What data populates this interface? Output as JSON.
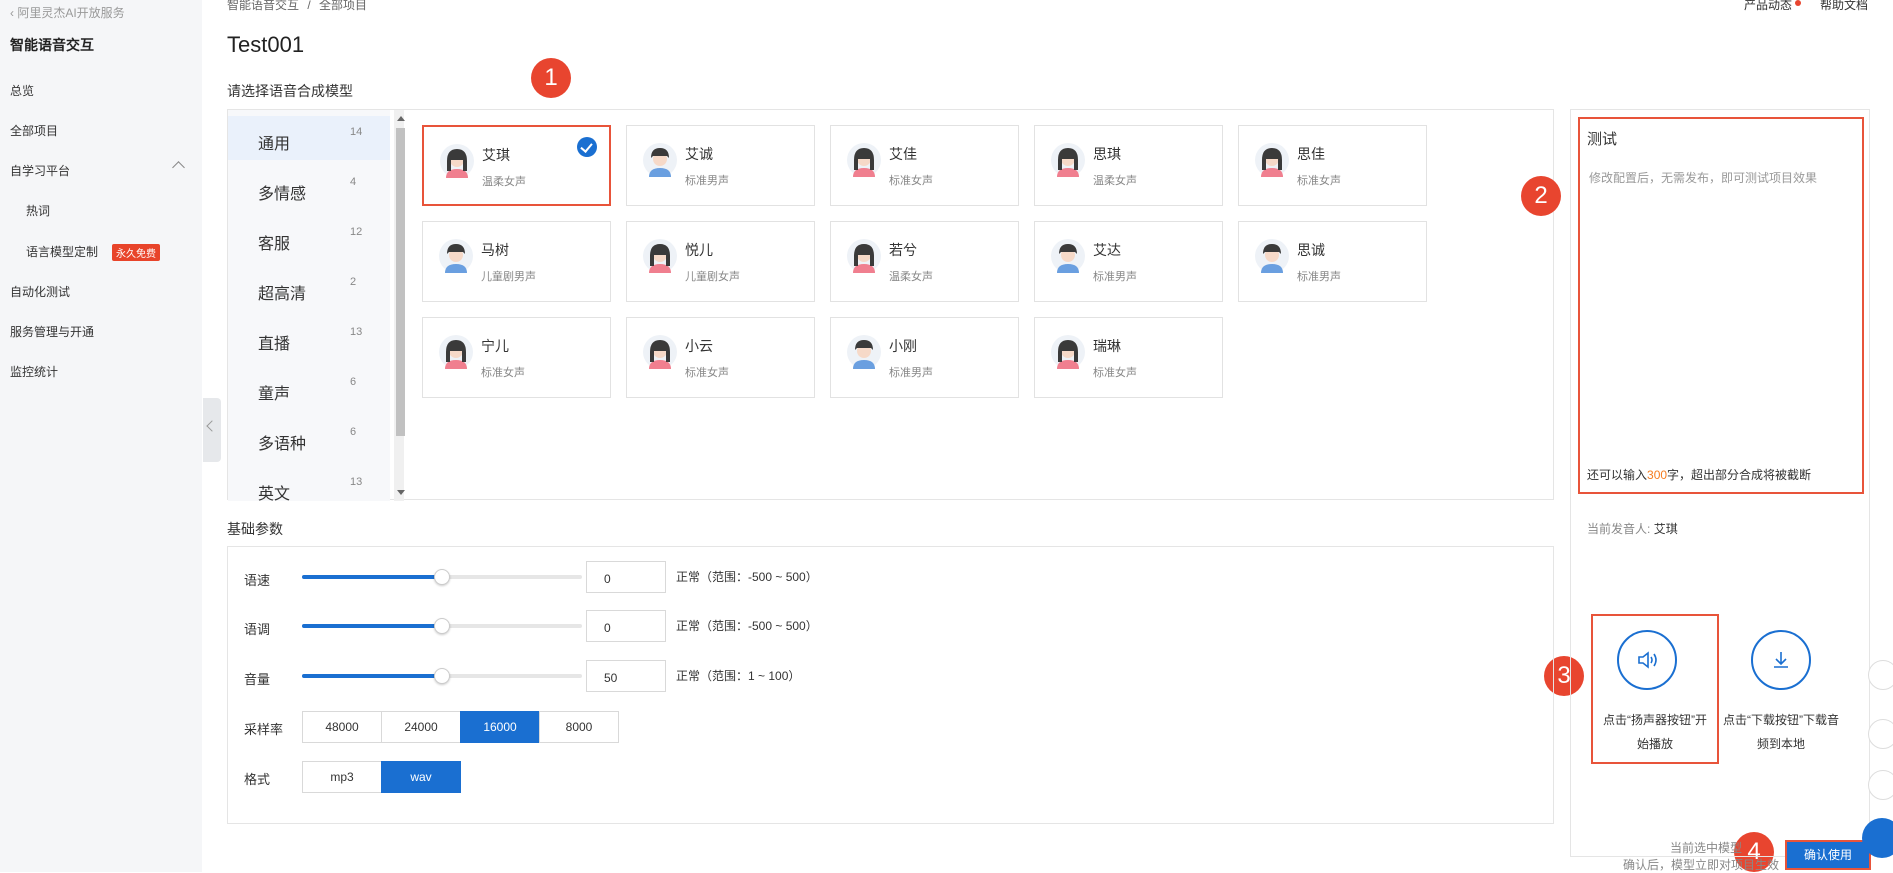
{
  "sidebar": {
    "back_label": "阿里灵杰AI开放服务",
    "title": "智能语音交互",
    "items": [
      {
        "label": "总览"
      },
      {
        "label": "全部项目"
      },
      {
        "label": "自学习平台"
      },
      {
        "label": "热词"
      },
      {
        "label": "语言模型定制"
      },
      {
        "label": "自动化测试"
      },
      {
        "label": "服务管理与开通"
      },
      {
        "label": "监控统计"
      }
    ],
    "free_badge": "永久免费"
  },
  "header": {
    "breadcrumb": [
      "智能语音交互",
      "/",
      "全部项目"
    ],
    "product_news": "产品动态",
    "help_docs": "帮助文档"
  },
  "page_title": "Test001",
  "model_section_label": "请选择语音合成模型",
  "categories": [
    {
      "name": "通用",
      "count": "14"
    },
    {
      "name": "多情感",
      "count": "4"
    },
    {
      "name": "客服",
      "count": "12"
    },
    {
      "name": "超高清",
      "count": "2"
    },
    {
      "name": "直播",
      "count": "13"
    },
    {
      "name": "童声",
      "count": "6"
    },
    {
      "name": "多语种",
      "count": "6"
    },
    {
      "name": "英文",
      "count": "13"
    }
  ],
  "voices": [
    {
      "name": "艾琪",
      "desc": "温柔女声",
      "gender": "female",
      "selected": true
    },
    {
      "name": "艾诚",
      "desc": "标准男声",
      "gender": "male"
    },
    {
      "name": "艾佳",
      "desc": "标准女声",
      "gender": "female"
    },
    {
      "name": "思琪",
      "desc": "温柔女声",
      "gender": "female"
    },
    {
      "name": "思佳",
      "desc": "标准女声",
      "gender": "female"
    },
    {
      "name": "马树",
      "desc": "儿童剧男声",
      "gender": "male"
    },
    {
      "name": "悦儿",
      "desc": "儿童剧女声",
      "gender": "female"
    },
    {
      "name": "若兮",
      "desc": "温柔女声",
      "gender": "female"
    },
    {
      "name": "艾达",
      "desc": "标准男声",
      "gender": "male"
    },
    {
      "name": "思诚",
      "desc": "标准男声",
      "gender": "male"
    },
    {
      "name": "宁儿",
      "desc": "标准女声",
      "gender": "female"
    },
    {
      "name": "小云",
      "desc": "标准女声",
      "gender": "female"
    },
    {
      "name": "小刚",
      "desc": "标准男声",
      "gender": "male"
    },
    {
      "name": "瑞琳",
      "desc": "标准女声",
      "gender": "female"
    }
  ],
  "annotations": [
    "1",
    "2",
    "3",
    "4"
  ],
  "test": {
    "title": "测试",
    "placeholder": "修改配置后，无需发布，即可测试项目效果",
    "count_prefix": "还可以输入",
    "count_value": "300",
    "count_suffix": "字，超出部分合成将被截断",
    "current_speaker_label": "当前发音人:",
    "current_speaker": "艾琪",
    "play_hint_line1": "点击“扬声器按钮”开",
    "play_hint_line2": "始播放",
    "download_hint_line1": "点击“下载按钮”下载音",
    "download_hint_line2": "频到本地"
  },
  "params": {
    "section_label": "基础参数",
    "speed": {
      "label": "语速",
      "value": "0",
      "range": "正常（范围：-500 ~ 500）",
      "level": 0.5
    },
    "pitch": {
      "label": "语调",
      "value": "0",
      "range": "正常（范围：-500 ~ 500）",
      "level": 0.5
    },
    "volume": {
      "label": "音量",
      "value": "50",
      "range": "正常（范围：1 ~ 100）",
      "level": 0.5
    },
    "sample_rate": {
      "label": "采样率",
      "options": [
        "48000",
        "24000",
        "16000",
        "8000"
      ],
      "selected": "16000"
    },
    "format": {
      "label": "格式",
      "options": [
        "mp3",
        "wav"
      ],
      "selected": "wav"
    }
  },
  "footer": {
    "line1": "当前选中模型",
    "line2": "确认后，模型立即对项目生效",
    "confirm_label": "确认使用"
  },
  "colors": {
    "accent": "#1a6fd1",
    "highlight": "#e8543a",
    "count": "#f57c20"
  }
}
